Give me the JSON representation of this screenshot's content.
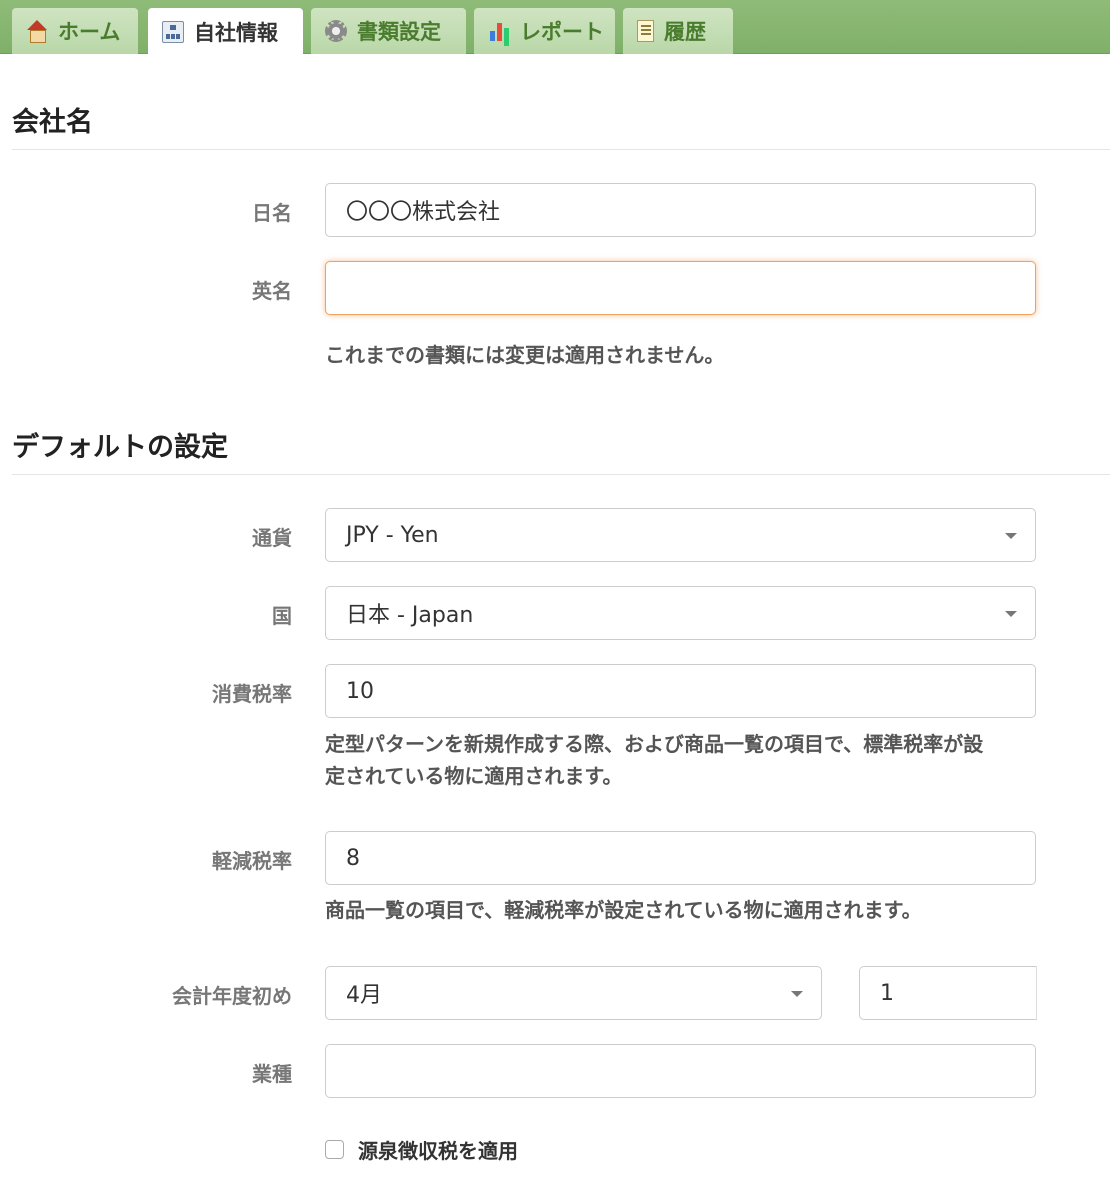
{
  "tabs": [
    {
      "label": "ホーム",
      "icon": "home-icon"
    },
    {
      "label": "自社情報",
      "icon": "organization-icon"
    },
    {
      "label": "書類設定",
      "icon": "gear-icon"
    },
    {
      "label": "レポート",
      "icon": "bar-chart-icon"
    },
    {
      "label": "履歴",
      "icon": "document-icon"
    }
  ],
  "active_tab": "自社情報",
  "company": {
    "heading": "会社名",
    "jp_label": "日名",
    "jp_value": "〇〇〇株式会社",
    "en_label": "英名",
    "en_value": "",
    "help": "これまでの書類には変更は適用されません。"
  },
  "defaults": {
    "heading": "デフォルトの設定",
    "currency_label": "通貨",
    "currency_value": "JPY - Yen",
    "country_label": "国",
    "country_value": "日本 - Japan",
    "tax_label": "消費税率",
    "tax_value": "10",
    "tax_help_line1": "定型パターンを新規作成する際、および商品一覧の項目で、標準税率が設",
    "tax_help_line2": "定されている物に適用されます。",
    "reduced_label": "軽減税率",
    "reduced_value": "8",
    "reduced_help": "商品一覧の項目で、軽減税率が設定されている物に適用されます。",
    "fiscal_label": "会計年度初め",
    "fiscal_month": "4月",
    "fiscal_day": "1",
    "industry_label": "業種",
    "industry_value": "",
    "withholding_label": "源泉徴収税を適用",
    "withholding_checked": false
  },
  "colors": {
    "tabbar": "#8fbc78",
    "tab_text": "#4a7c2e",
    "focus_border": "#f0a060"
  }
}
